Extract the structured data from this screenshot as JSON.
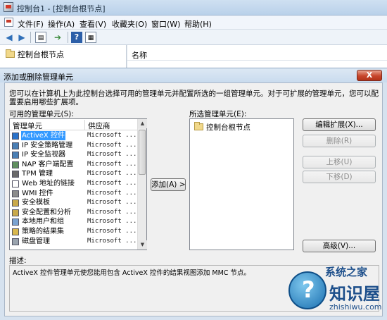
{
  "main_window": {
    "title": "控制台1 - [控制台根节点]",
    "menu": [
      "文件(F)",
      "操作(A)",
      "查看(V)",
      "收藏夹(O)",
      "窗口(W)",
      "帮助(H)"
    ],
    "tree_root": "控制台根节点",
    "list_column": "名称"
  },
  "dialog": {
    "title": "添加或删除管理单元",
    "close_glyph": "X",
    "intro": "您可以在计算机上为此控制台选择可用的管理单元并配置所选的一组管理单元。对于可扩展的管理单元，您可以配置要启用哪些扩展项。",
    "available_label": "可用的管理单元(S):",
    "columns": [
      "管理单元",
      "供应商"
    ],
    "snapins": [
      {
        "name": "ActiveX 控件",
        "vendor": "Microsoft ...",
        "selected": true
      },
      {
        "name": "IP 安全策略管理",
        "vendor": "Microsoft ..."
      },
      {
        "name": "IP 安全监视器",
        "vendor": "Microsoft ..."
      },
      {
        "name": "NAP 客户端配置",
        "vendor": "Microsoft ..."
      },
      {
        "name": "TPM 管理",
        "vendor": "Microsoft ..."
      },
      {
        "name": "Web 地址的链接",
        "vendor": "Microsoft ..."
      },
      {
        "name": "WMI 控件",
        "vendor": "Microsoft ..."
      },
      {
        "name": "安全模板",
        "vendor": "Microsoft ..."
      },
      {
        "name": "安全配置和分析",
        "vendor": "Microsoft ..."
      },
      {
        "name": "本地用户和组",
        "vendor": "Microsoft ..."
      },
      {
        "name": "策略的结果集",
        "vendor": "Microsoft ..."
      },
      {
        "name": "磁盘管理",
        "vendor": "Microsoft ..."
      }
    ],
    "add_button": "添加(A) >",
    "selected_label": "所选管理单元(E):",
    "selected_items": [
      "控制台根节点"
    ],
    "right_buttons": {
      "edit_ext": "编辑扩展(X)...",
      "remove": "删除(R)",
      "move_up": "上移(U)",
      "move_down": "下移(D)",
      "advanced": "高级(V)..."
    },
    "description_label": "描述:",
    "description_text": "ActiveX 控件管理单元使您能用包含 ActiveX 控件的结果视图添加 MMC 节点。"
  },
  "watermark": {
    "line1": "系统之家",
    "line2": "知识屋",
    "line3": "zhishiwu.com"
  }
}
